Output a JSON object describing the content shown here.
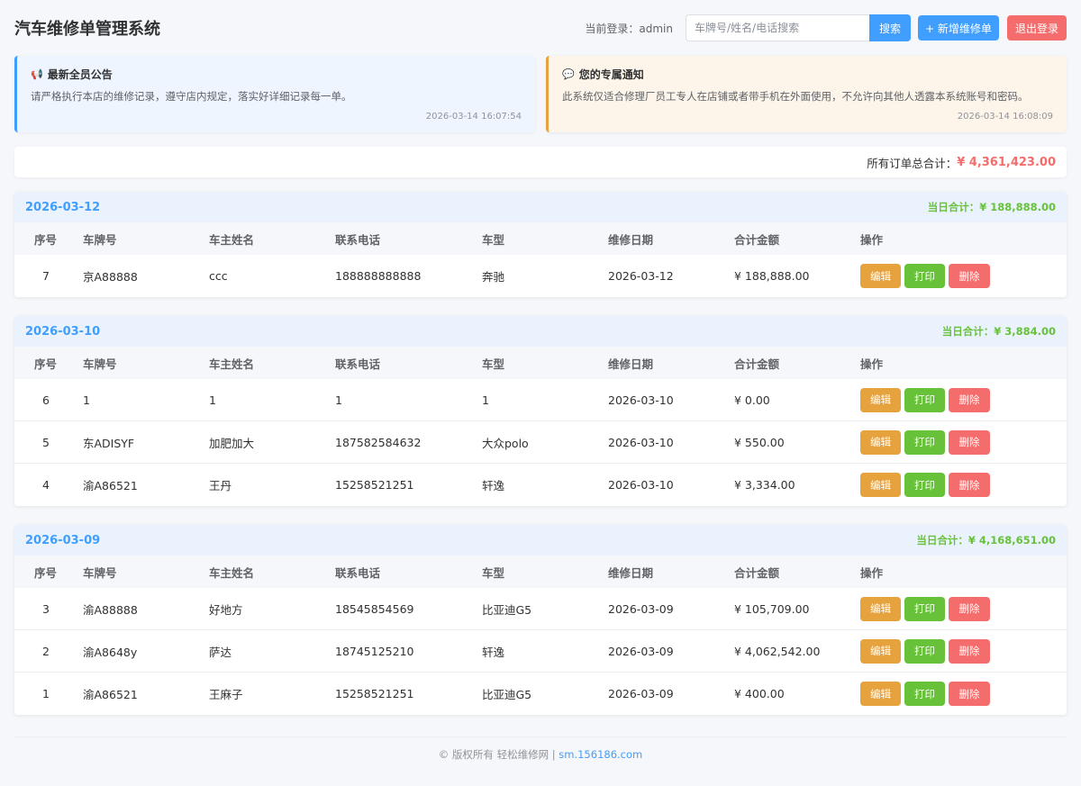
{
  "header": {
    "title": "汽车维修单管理系统",
    "login_label": "当前登录：admin",
    "search_placeholder": "车牌号/姓名/电话搜索",
    "search_button": "搜索",
    "add_button": "+ 新增维修单",
    "logout_button": "退出登录"
  },
  "notices": [
    {
      "icon": "📢",
      "title": "最新全员公告",
      "body": "请严格执行本店的维修记录，遵守店内规定，落实好详细记录每一单。",
      "time": "2026-03-14 16:07:54"
    },
    {
      "icon": "💬",
      "title": "您的专属通知",
      "body": "此系统仅适合修理厂员工专人在店铺或者带手机在外面使用，不允许向其他人透露本系统账号和密码。",
      "time": "2026-03-14 16:08:09"
    }
  ],
  "summary": {
    "label": "所有订单总合计：",
    "value": "¥ 4,361,423.00"
  },
  "columns": [
    "序号",
    "车牌号",
    "车主姓名",
    "联系电话",
    "车型",
    "维修日期",
    "合计金额",
    "操作"
  ],
  "actions": {
    "edit": "编辑",
    "print": "打印",
    "delete": "删除"
  },
  "groups": [
    {
      "date": "2026-03-12",
      "total": "当日合计：¥ 188,888.00",
      "rows": [
        {
          "no": "7",
          "plate": "京A88888",
          "owner": "ccc",
          "phone": "188888888888",
          "model": "奔驰",
          "date": "2026-03-12",
          "amount": "¥ 188,888.00"
        }
      ]
    },
    {
      "date": "2026-03-10",
      "total": "当日合计：¥ 3,884.00",
      "rows": [
        {
          "no": "6",
          "plate": "1",
          "owner": "1",
          "phone": "1",
          "model": "1",
          "date": "2026-03-10",
          "amount": "¥ 0.00"
        },
        {
          "no": "5",
          "plate": "东ADISYF",
          "owner": "加肥加大",
          "phone": "187582584632",
          "model": "大众polo",
          "date": "2026-03-10",
          "amount": "¥ 550.00"
        },
        {
          "no": "4",
          "plate": "渝A86521",
          "owner": "王丹",
          "phone": "15258521251",
          "model": "轩逸",
          "date": "2026-03-10",
          "amount": "¥ 3,334.00"
        }
      ]
    },
    {
      "date": "2026-03-09",
      "total": "当日合计：¥ 4,168,651.00",
      "rows": [
        {
          "no": "3",
          "plate": "渝A88888",
          "owner": "好地方",
          "phone": "18545854569",
          "model": "比亚迪G5",
          "date": "2026-03-09",
          "amount": "¥ 105,709.00"
        },
        {
          "no": "2",
          "plate": "渝A8648y",
          "owner": "萨达",
          "phone": "18745125210",
          "model": "轩逸",
          "date": "2026-03-09",
          "amount": "¥ 4,062,542.00"
        },
        {
          "no": "1",
          "plate": "渝A86521",
          "owner": "王麻子",
          "phone": "15258521251",
          "model": "比亚迪G5",
          "date": "2026-03-09",
          "amount": "¥ 400.00"
        }
      ]
    }
  ],
  "footer": {
    "text": "© 版权所有 轻松维修网 |",
    "link": "sm.156186.com"
  }
}
